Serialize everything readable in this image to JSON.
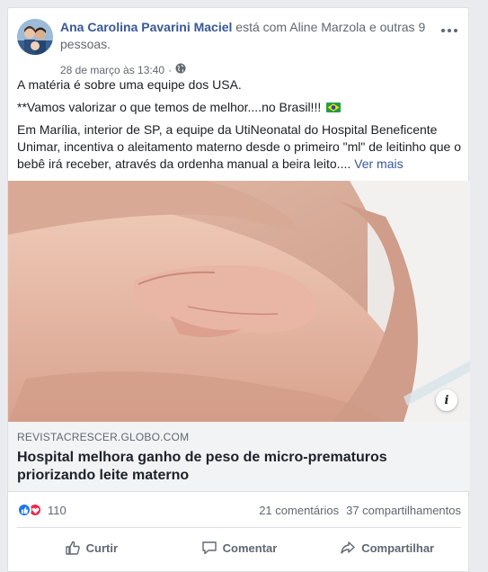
{
  "post": {
    "author": "Ana Carolina Pavarini Maciel",
    "with_text": "está com",
    "tagged": "Aline Marzola",
    "and_text": "e",
    "others": "outras 9 pessoas.",
    "timestamp": "28 de março às 13:40",
    "dot": "·",
    "audience_icon": "globe-icon",
    "more_icon": "ellipsis-icon",
    "paragraphs": [
      "A matéria é sobre uma equipe dos USA.",
      "**Vamos valorizar o que temos de melhor....no Brasil!!! ",
      "Em Marília, interior de SP, a equipe da UtiNeonatal do Hospital Beneficente Unimar, incentiva o aleitamento materno desde o primeiro \"ml\" de leitinho que o bebê irá receber, através da ordenha manual a beira leito.... "
    ],
    "see_more": "Ver mais"
  },
  "link": {
    "domain": "REVISTACRESCER.GLOBO.COM",
    "title": "Hospital melhora ganho de peso de micro-prematuros priorizando leite materno",
    "info_label": "i"
  },
  "stats": {
    "reaction_count": "110",
    "comments": "21 comentários",
    "shares": "37 compartilhamentos"
  },
  "actions": {
    "like": "Curtir",
    "comment": "Comentar",
    "share": "Compartilhar"
  },
  "colors": {
    "link_blue": "#385898",
    "like_blue": "#1877f2",
    "love_red": "#f0284a"
  }
}
